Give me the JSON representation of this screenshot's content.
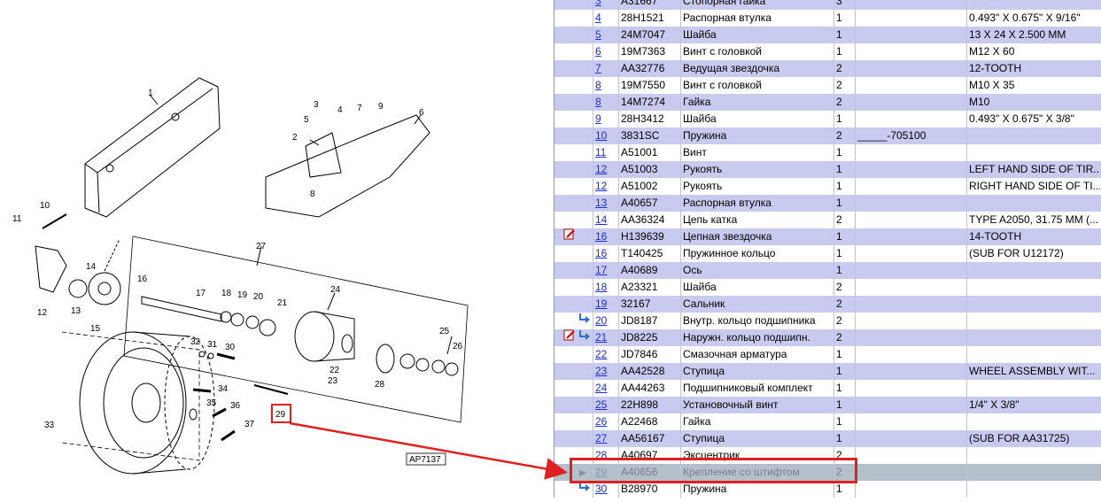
{
  "diagram": {
    "callouts": [
      "1",
      "2",
      "3",
      "4",
      "5",
      "6",
      "7",
      "8",
      "9",
      "10",
      "11",
      "12",
      "13",
      "14",
      "15",
      "16",
      "17",
      "18",
      "19",
      "20",
      "21",
      "22",
      "23",
      "24",
      "25",
      "26",
      "27",
      "28",
      "29",
      "30",
      "31",
      "32",
      "33",
      "34",
      "35",
      "36",
      "37"
    ],
    "figure_code": "AP7137",
    "highlighted_callout": "29"
  },
  "parts": {
    "rows": [
      {
        "pos": "3",
        "code": "A31667",
        "name": "Стопорная гайка",
        "qty": "3",
        "serial": "",
        "remark": "",
        "mark": "",
        "alt": true
      },
      {
        "pos": "4",
        "code": "28H1521",
        "name": "Распорная втулка",
        "qty": "1",
        "serial": "",
        "remark": "0.493\" X 0.675\" X 9/16\"",
        "mark": "",
        "alt": false
      },
      {
        "pos": "5",
        "code": "24M7047",
        "name": "Шайба",
        "qty": "1",
        "serial": "",
        "remark": "13 X 24 X 2.500 MM",
        "mark": "",
        "alt": true
      },
      {
        "pos": "6",
        "code": "19M7363",
        "name": "Винт с головкой",
        "qty": "1",
        "serial": "",
        "remark": "M12 X 60",
        "mark": "",
        "alt": false
      },
      {
        "pos": "7",
        "code": "AA32776",
        "name": "Ведущая звездочка",
        "qty": "2",
        "serial": "",
        "remark": "12-TOOTH",
        "mark": "",
        "alt": true
      },
      {
        "pos": "8",
        "code": "19M7550",
        "name": "Винт с головкой",
        "qty": "2",
        "serial": "",
        "remark": "M10 X 35",
        "mark": "",
        "alt": false
      },
      {
        "pos": "8",
        "code": "14M7274",
        "name": "Гайка",
        "qty": "2",
        "serial": "",
        "remark": "M10",
        "mark": "",
        "alt": true
      },
      {
        "pos": "9",
        "code": "28H3412",
        "name": "Шайба",
        "qty": "1",
        "serial": "",
        "remark": "0.493\" X 0.675\" X 3/8\"",
        "mark": "",
        "alt": false
      },
      {
        "pos": "10",
        "code": "3831SC",
        "name": "Пружина",
        "qty": "2",
        "serial": "_____-705100",
        "remark": "",
        "mark": "",
        "alt": true
      },
      {
        "pos": "11",
        "code": "A51001",
        "name": "Винт",
        "qty": "1",
        "serial": "",
        "remark": "",
        "mark": "",
        "alt": false
      },
      {
        "pos": "12",
        "code": "A51003",
        "name": "Рукоять",
        "qty": "1",
        "serial": "",
        "remark": "LEFT HAND SIDE OF TIR...",
        "mark": "",
        "alt": true
      },
      {
        "pos": "12",
        "code": "A51002",
        "name": "Рукоять",
        "qty": "1",
        "serial": "",
        "remark": "RIGHT HAND SIDE OF TI...",
        "mark": "",
        "alt": false
      },
      {
        "pos": "13",
        "code": "A40657",
        "name": "Распорная втулка",
        "qty": "1",
        "serial": "",
        "remark": "",
        "mark": "",
        "alt": true
      },
      {
        "pos": "14",
        "code": "AA36324",
        "name": "Цепь катка",
        "qty": "2",
        "serial": "",
        "remark": "TYPE A2050, 31.75 MM (...",
        "mark": "",
        "alt": false
      },
      {
        "pos": "16",
        "code": "H139639",
        "name": "Цепная звездочка",
        "qty": "1",
        "serial": "",
        "remark": "14-TOOTH",
        "mark": "note",
        "alt": true
      },
      {
        "pos": "16",
        "code": "T140425",
        "name": "Пружинное кольцо",
        "qty": "1",
        "serial": "",
        "remark": "(SUB FOR U12172)",
        "mark": "",
        "alt": false
      },
      {
        "pos": "17",
        "code": "A40689",
        "name": "Ось",
        "qty": "1",
        "serial": "",
        "remark": "",
        "mark": "",
        "alt": true
      },
      {
        "pos": "18",
        "code": "A23321",
        "name": "Шайба",
        "qty": "2",
        "serial": "",
        "remark": "",
        "mark": "",
        "alt": false
      },
      {
        "pos": "19",
        "code": "32167",
        "name": "Сальник",
        "qty": "2",
        "serial": "",
        "remark": "",
        "mark": "",
        "alt": true
      },
      {
        "pos": "20",
        "code": "JD8187",
        "name": "Внутр. кольцо подшипника",
        "qty": "2",
        "serial": "",
        "remark": "",
        "mark": "arrow",
        "alt": false
      },
      {
        "pos": "21",
        "code": "JD8225",
        "name": "Наружн. кольцо подшипн.",
        "qty": "2",
        "serial": "",
        "remark": "",
        "mark": "note-arrow",
        "alt": true
      },
      {
        "pos": "22",
        "code": "JD7846",
        "name": "Смазочная арматура",
        "qty": "1",
        "serial": "",
        "remark": "",
        "mark": "",
        "alt": false
      },
      {
        "pos": "23",
        "code": "AA42528",
        "name": "Ступица",
        "qty": "1",
        "serial": "",
        "remark": "WHEEL ASSEMBLY WIT...",
        "mark": "",
        "alt": true
      },
      {
        "pos": "24",
        "code": "AA44263",
        "name": "Подшипниковый комплект",
        "qty": "1",
        "serial": "",
        "remark": "",
        "mark": "",
        "alt": false
      },
      {
        "pos": "25",
        "code": "22H898",
        "name": "Установочный винт",
        "qty": "1",
        "serial": "",
        "remark": "1/4\" X 3/8\"",
        "mark": "",
        "alt": true
      },
      {
        "pos": "26",
        "code": "A22468",
        "name": "Гайка",
        "qty": "1",
        "serial": "",
        "remark": "",
        "mark": "",
        "alt": false
      },
      {
        "pos": "27",
        "code": "AA56167",
        "name": "Ступица",
        "qty": "1",
        "serial": "",
        "remark": "(SUB FOR AA31725)",
        "mark": "",
        "alt": true
      },
      {
        "pos": "28",
        "code": "A40697",
        "name": "Эксцентрик",
        "qty": "2",
        "serial": "",
        "remark": "",
        "mark": "",
        "alt": false
      },
      {
        "pos": "29",
        "code": "A40656",
        "name": "Крепление со штифтом",
        "qty": "2",
        "serial": "",
        "remark": "",
        "mark": "",
        "alt": false,
        "selected": true
      },
      {
        "pos": "30",
        "code": "B28970",
        "name": "Пружина",
        "qty": "1",
        "serial": "",
        "remark": "",
        "mark": "arrow",
        "alt": false
      }
    ]
  },
  "colors": {
    "row_alt": "#c8caf0",
    "row_selected": "#b4bfcc",
    "link": "#1a2fd0",
    "highlight": "#e02020"
  }
}
